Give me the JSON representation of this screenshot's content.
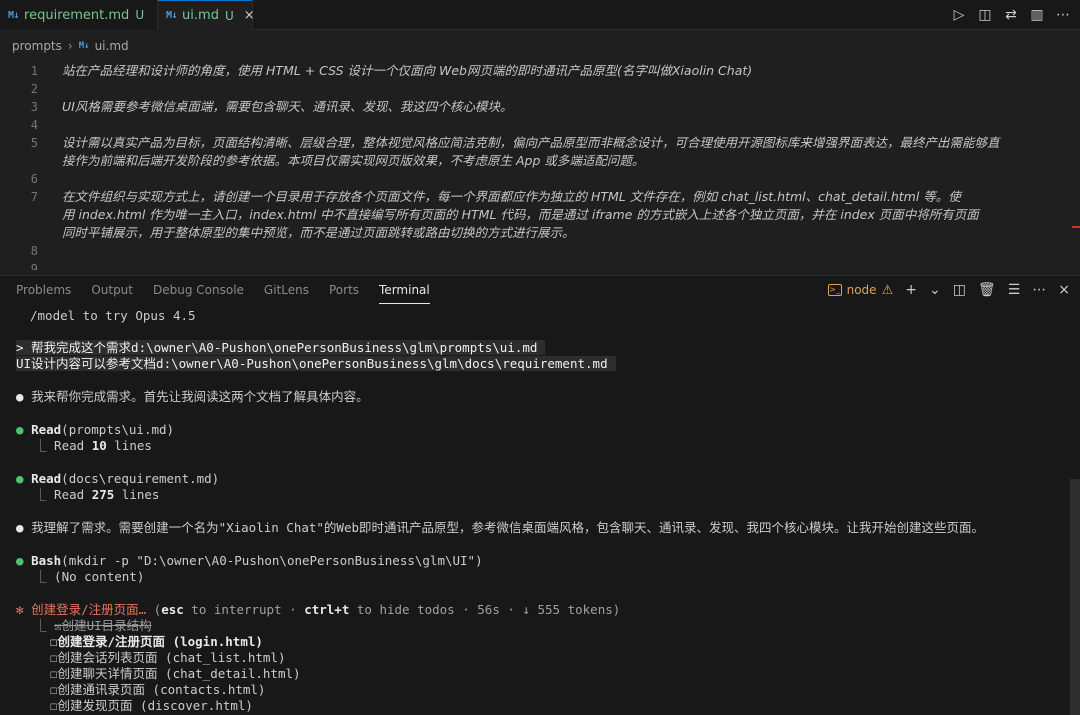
{
  "tabs": [
    {
      "icon": "M↓",
      "name": "requirement.md",
      "flag": "U",
      "active": false
    },
    {
      "icon": "M↓",
      "name": "ui.md",
      "flag": "U",
      "active": true,
      "close": "×"
    }
  ],
  "tab_actions": [
    "run-icon",
    "open-preview-icon",
    "compare-icon",
    "split-editor-icon",
    "more-icon"
  ],
  "breadcrumb": {
    "folder": "prompts",
    "icon": "M↓",
    "file": "ui.md"
  },
  "editor_lines": [
    {
      "n": "1",
      "text": "站在产品经理和设计师的角度，使用 HTML + CSS 设计一个仅面向 Web网页端的即时通讯产品原型(名字叫做Xiaolin Chat)"
    },
    {
      "n": "2",
      "text": ""
    },
    {
      "n": "3",
      "text": "UI风格需要参考微信桌面端，需要包含聊天、通讯录、发现、我这四个核心模块。"
    },
    {
      "n": "4",
      "text": ""
    },
    {
      "n": "5",
      "text": "设计需以真实产品为目标，页面结构清晰、层级合理，整体视觉风格应简洁克制，偏向产品原型而非概念设计，可合理使用开源图标库来增强界面表达，最终产出需能够直",
      "text2": "接作为前端和后端开发阶段的参考依据。本项目仅需实现网页版效果，不考虑原生 App 或多端适配问题。"
    },
    {
      "n": "6",
      "text": ""
    },
    {
      "n": "7",
      "text": "在文件组织与实现方式上，请创建一个目录用于存放各个页面文件，每一个界面都应作为独立的 HTML 文件存在，例如 chat_list.html、chat_detail.html 等。使",
      "text2": "用 index.html 作为唯一主入口，index.html 中不直接编写所有页面的 HTML 代码，而是通过 iframe 的方式嵌入上述各个独立页面，并在 index 页面中将所有页面",
      "text3": "同时平铺展示，用于整体原型的集中预览，而不是通过页面跳转或路由切换的方式进行展示。"
    },
    {
      "n": "8",
      "text": ""
    },
    {
      "n": "9",
      "text": ""
    }
  ],
  "panel_tabs": [
    "Problems",
    "Output",
    "Debug Console",
    "GitLens",
    "Ports",
    "Terminal"
  ],
  "panel_node_label": "node",
  "terminal": {
    "model_hint": "/model to try Opus 4.5",
    "prompt_line1": "> 帮我完成这个需求d:\\owner\\A0-Pushon\\onePersonBusiness\\glm\\prompts\\ui.md",
    "prompt_line2": "UI设计内容可以参考文档d:\\owner\\A0-Pushon\\onePersonBusiness\\glm\\docs\\requirement.md",
    "msg1": "我来帮你完成需求。首先让我阅读这两个文档了解具体内容。",
    "read1_cmd": "Read",
    "read1_arg": "(prompts\\ui.md)",
    "read1_res_pre": "Read ",
    "read1_res_num": "10",
    "read1_res_post": " lines",
    "read2_cmd": "Read",
    "read2_arg": "(docs\\requirement.md)",
    "read2_res_pre": "Read ",
    "read2_res_num": "275",
    "read2_res_post": " lines",
    "msg2": "我理解了需求。需要创建一个名为\"Xiaolin Chat\"的Web即时通讯产品原型，参考微信桌面端风格，包含聊天、通讯录、发现、我四个核心模块。让我开始创建这些页面。",
    "bash_cmd": "Bash",
    "bash_arg": "(mkdir -p \"D:\\owner\\A0-Pushon\\onePersonBusiness\\glm\\UI\")",
    "bash_res": "(No content)",
    "status_title": "创建登录/注册页面…",
    "status_hint_pre": "(",
    "status_esc": "esc",
    "status_mid1": " to interrupt · ",
    "status_ctrl": "ctrl+t",
    "status_mid2": " to hide todos · 56s · ↓ 555 tokens)",
    "todos": [
      {
        "box": "☒",
        "text": "创建UI目录结构",
        "state": "done"
      },
      {
        "box": "☐",
        "text": "创建登录/注册页面 (login.html)",
        "state": "active"
      },
      {
        "box": "☐",
        "text": "创建会话列表页面 (chat_list.html)",
        "state": "pending"
      },
      {
        "box": "☐",
        "text": "创建聊天详情页面 (chat_detail.html)",
        "state": "pending"
      },
      {
        "box": "☐",
        "text": "创建通讯录页面 (contacts.html)",
        "state": "pending"
      },
      {
        "box": "☐",
        "text": "创建发现页面 (discover.html)",
        "state": "pending"
      }
    ]
  },
  "colors": {
    "accent": "#0078d4",
    "git_untracked": "#73c991",
    "ok_dot": "#4ec36f",
    "warn": "#e0a15a",
    "status": "#e9735e"
  }
}
